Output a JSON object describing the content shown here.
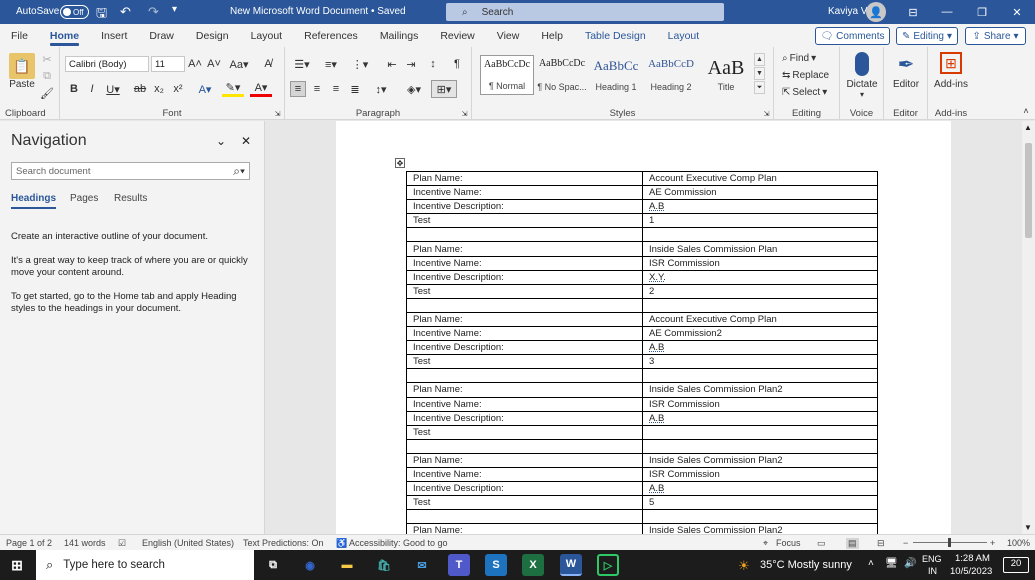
{
  "titlebar": {
    "autosave": "AutoSave",
    "toggle": "Off",
    "doc_title": "New Microsoft Word Document • Saved",
    "search_placeholder": "Search",
    "user": "Kaviya V"
  },
  "tabs": [
    "File",
    "Home",
    "Insert",
    "Draw",
    "Design",
    "Layout",
    "References",
    "Mailings",
    "Review",
    "View",
    "Help",
    "Table Design",
    "Layout"
  ],
  "tab_buttons": {
    "comments": "Comments",
    "editing": "Editing",
    "share": "Share"
  },
  "ribbon": {
    "clipboard": {
      "paste": "Paste",
      "label": "Clipboard"
    },
    "font": {
      "name": "Calibri (Body)",
      "size": "11",
      "label": "Font"
    },
    "paragraph": {
      "label": "Paragraph"
    },
    "styles": {
      "label": "Styles",
      "items": [
        {
          "preview": "AaBbCcDc",
          "name": "¶ Normal"
        },
        {
          "preview": "AaBbCcDc",
          "name": "¶ No Spac..."
        },
        {
          "preview": "AaBbCc",
          "name": "Heading 1"
        },
        {
          "preview": "AaBbCcD",
          "name": "Heading 2"
        },
        {
          "preview": "AaB",
          "name": "Title"
        }
      ]
    },
    "editing": {
      "find": "Find",
      "replace": "Replace",
      "select": "Select",
      "label": "Editing"
    },
    "voice": {
      "dictate": "Dictate",
      "label": "Voice"
    },
    "editor": {
      "editor": "Editor",
      "label": "Editor"
    },
    "addins": {
      "addins": "Add-ins",
      "label": "Add-ins"
    }
  },
  "nav": {
    "title": "Navigation",
    "search_placeholder": "Search document",
    "tabs": [
      "Headings",
      "Pages",
      "Results"
    ],
    "p1": "Create an interactive outline of your document.",
    "p2": "It's a great way to keep track of where you are or quickly move your content around.",
    "p3": "To get started, go to the Home tab and apply Heading styles to the headings in your document."
  },
  "table": [
    [
      "Plan Name:",
      "Account Executive Comp Plan"
    ],
    [
      "Incentive Name:",
      "AE Commission"
    ],
    [
      "Incentive Description:",
      "A.B"
    ],
    [
      "Test",
      "1"
    ],
    [
      "",
      ""
    ],
    [
      "Plan Name:",
      "Inside Sales Commission Plan"
    ],
    [
      "Incentive Name:",
      "ISR Commission"
    ],
    [
      "Incentive Description:",
      "X.Y."
    ],
    [
      "Test",
      "2"
    ],
    [
      "",
      ""
    ],
    [
      "Plan Name:",
      "Account Executive Comp Plan"
    ],
    [
      "Incentive Name:",
      "AE Commission2"
    ],
    [
      "Incentive Description:",
      "A.B"
    ],
    [
      "Test",
      "3"
    ],
    [
      "",
      ""
    ],
    [
      "Plan Name:",
      "Inside Sales Commission Plan2"
    ],
    [
      "Incentive Name:",
      "ISR Commission"
    ],
    [
      "Incentive Description:",
      "A.B"
    ],
    [
      "Test",
      ""
    ],
    [
      "",
      ""
    ],
    [
      "Plan Name:",
      "Inside Sales Commission Plan2"
    ],
    [
      "Incentive Name:",
      "ISR Commission"
    ],
    [
      "Incentive Description:",
      "A.B"
    ],
    [
      "Test",
      "5"
    ],
    [
      "",
      ""
    ],
    [
      "Plan Name:",
      "Inside Sales Commission Plan2"
    ]
  ],
  "status": {
    "page": "Page 1 of 2",
    "words": "141 words",
    "lang": "English (United States)",
    "pred": "Text Predictions: On",
    "access": "Accessibility: Good to go",
    "focus": "Focus",
    "zoom": "100%"
  },
  "taskbar": {
    "search": "Type here to search",
    "weather": "35°C  Mostly sunny",
    "lang1": "ENG",
    "lang2": "IN",
    "time": "1:28 AM",
    "date": "10/5/2023",
    "notif": "20"
  }
}
